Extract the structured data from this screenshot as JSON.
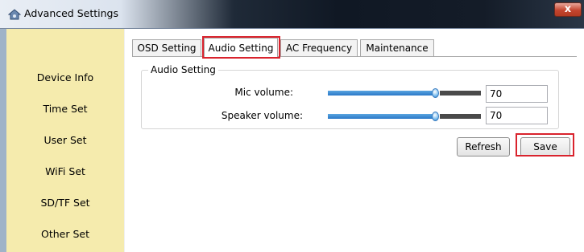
{
  "window": {
    "title": "Advanced Settings",
    "close_label": "x"
  },
  "sidebar": {
    "items": [
      {
        "label": "Device Info"
      },
      {
        "label": "Time Set"
      },
      {
        "label": "User Set"
      },
      {
        "label": "WiFi Set"
      },
      {
        "label": "SD/TF Set"
      },
      {
        "label": "Other Set"
      }
    ]
  },
  "tabs": [
    {
      "label": "OSD Setting",
      "active": false
    },
    {
      "label": "Audio Setting",
      "active": true
    },
    {
      "label": "AC Frequency",
      "active": false
    },
    {
      "label": "Maintenance",
      "active": false
    }
  ],
  "audio": {
    "group_title": "Audio Setting",
    "mic": {
      "label": "Mic volume:",
      "value": "70",
      "level": 0.7
    },
    "speaker": {
      "label": "Speaker volume:",
      "value": "70",
      "level": 0.7
    }
  },
  "buttons": {
    "refresh": "Refresh",
    "save": "Save"
  },
  "colors": {
    "sidebar_bg": "#f5ebad",
    "highlight": "#d9232d",
    "slider_fill": "#2a78c8",
    "close_button": "#c4452f"
  }
}
